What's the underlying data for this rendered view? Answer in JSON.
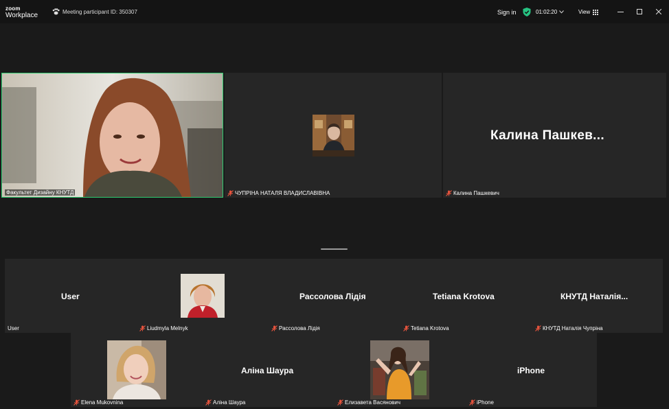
{
  "app": {
    "brand_line1": "zoom",
    "brand_line2": "Workplace",
    "meeting_id": "Meeting participant ID: 350307",
    "sign_in": "Sign in",
    "timer": "01:02:20",
    "view": "View"
  },
  "colors": {
    "active_speaker_border": "#2ecc71",
    "tile_bg": "#262626",
    "stage_bg": "#1a1a1a",
    "mic_muted": "#e5533d",
    "shield_green": "#26c281"
  },
  "top_row": [
    {
      "label": "Факультет Дизайну КНУТД",
      "video": true
    },
    {
      "label": "ЧУПРІНА НАТАЛЯ ВЛАДИСЛАВІВНА",
      "muted": true
    },
    {
      "label": "Калина Пашкевич",
      "display": "Калина  Пашкев...",
      "muted": true
    }
  ],
  "middle_row": [
    {
      "label": "User",
      "display": "User"
    },
    {
      "label": "Liudmyla Melnyk",
      "muted": true
    },
    {
      "label": "Рассолова Лідія",
      "display": "Рассолова Лідія",
      "muted": true
    },
    {
      "label": "Tetiana Krotova",
      "display": "Tetiana Krotova",
      "muted": true
    },
    {
      "label": "КНУТД Наталія Чупріна",
      "display": "КНУТД  Наталія...",
      "muted": true
    }
  ],
  "bottom_row": [
    {
      "label": "Elena Mukovnina",
      "muted": true
    },
    {
      "label": "Аліна Шаура",
      "display": "Аліна Шаура",
      "muted": true
    },
    {
      "label": "Елизавета Васянович",
      "muted": true
    },
    {
      "label": "iPhone",
      "display": "iPhone",
      "muted": true
    }
  ]
}
